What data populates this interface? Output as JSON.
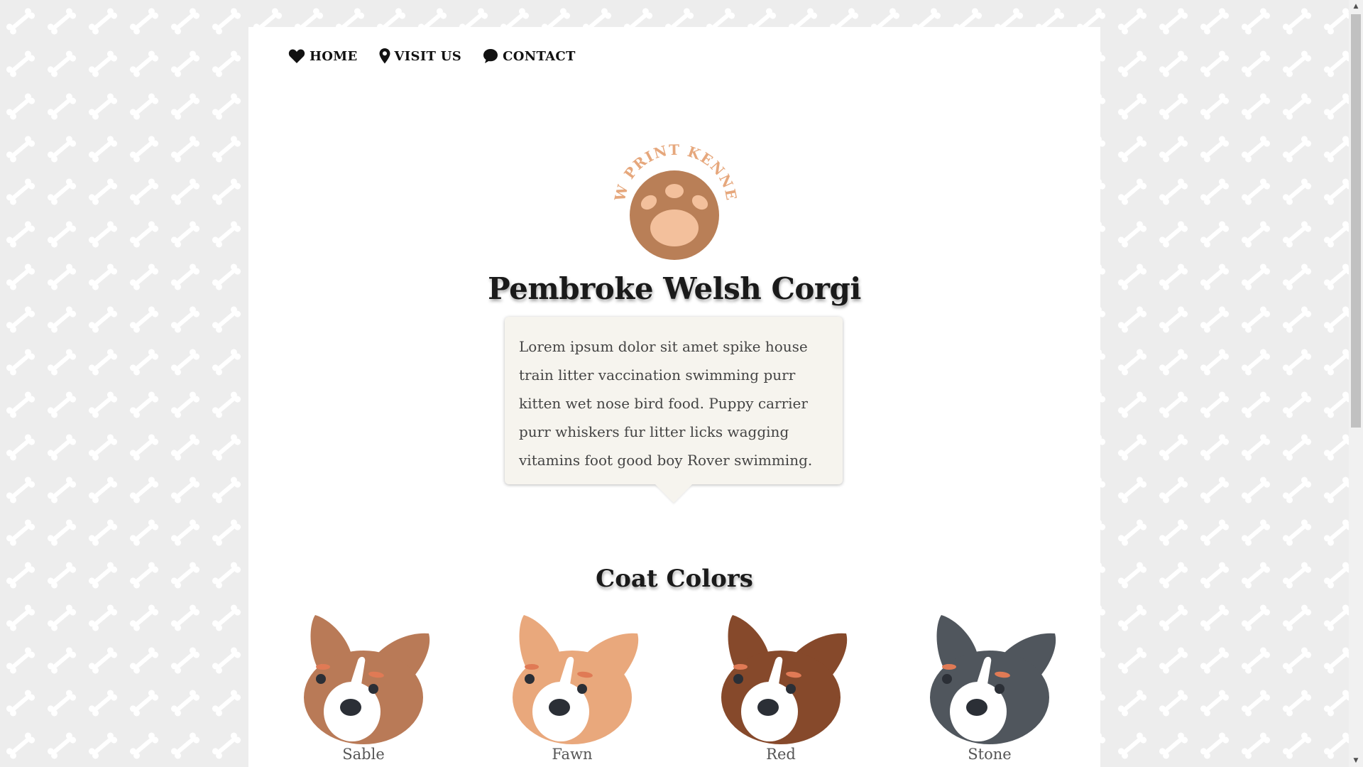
{
  "nav": {
    "items": [
      {
        "label": "HOME",
        "icon": "heart-icon"
      },
      {
        "label": "VISIT US",
        "icon": "map-pin-icon"
      },
      {
        "label": "CONTACT",
        "icon": "chat-bubble-icon"
      }
    ]
  },
  "logo": {
    "text": "PAW PRINT KENNELS",
    "icon": "paw-print-icon",
    "colors": {
      "ring": "#e6a77c",
      "circle": "#b97f57",
      "pad": "#f3c09c"
    }
  },
  "page_title": "Pembroke Welsh Corgi",
  "description": "Lorem ipsum dolor sit amet spike house train litter vaccination swimming purr kitten wet nose bird food. Puppy carrier purr whiskers fur litter licks wagging vitamins foot good boy Rover swimming.",
  "coat_colors": {
    "title": "Coat Colors",
    "items": [
      {
        "label": "Sable",
        "color": "#b97a57"
      },
      {
        "label": "Fawn",
        "color": "#e9a87c"
      },
      {
        "label": "Red",
        "color": "#86492b"
      },
      {
        "label": "Stone",
        "color": "#50565d"
      }
    ]
  },
  "theme": {
    "background": "#ededed",
    "pattern": "bone-icon",
    "text": "#1a1a1a",
    "bubble": "#f6f4ee"
  }
}
